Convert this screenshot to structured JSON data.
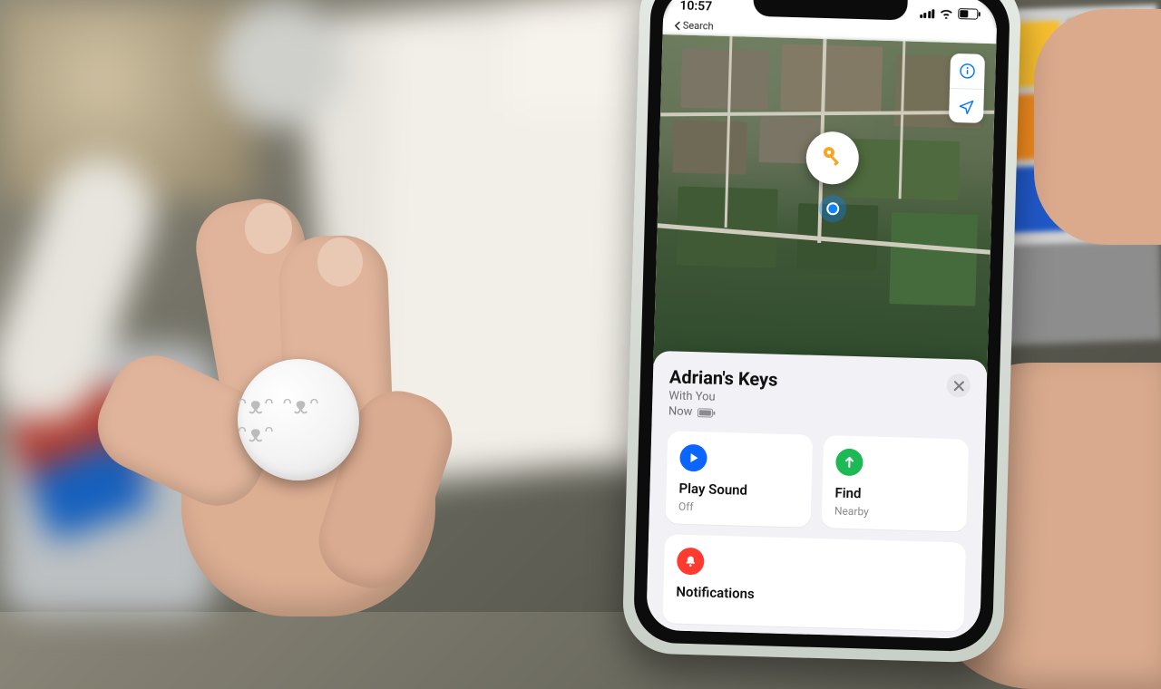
{
  "status_bar": {
    "time": "10:57",
    "back_label": "Search"
  },
  "map": {
    "pin_icon": "key-icon"
  },
  "sheet": {
    "title": "Adrian's Keys",
    "status_line1": "With You",
    "status_line2": "Now",
    "actions": {
      "play_sound": {
        "title": "Play Sound",
        "subtitle": "Off"
      },
      "find": {
        "title": "Find",
        "subtitle": "Nearby"
      },
      "notifications": {
        "title": "Notifications"
      }
    }
  },
  "airtag": {
    "engraving": "ᵔᴥᵔ ᵔᴥᵔ ᵔᴥᵔ"
  }
}
